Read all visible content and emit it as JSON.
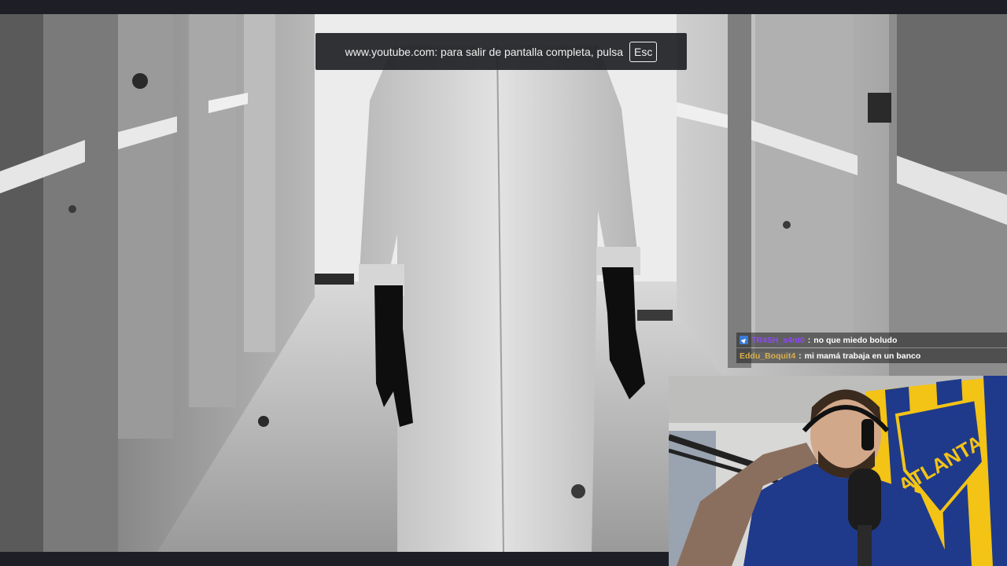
{
  "notice": {
    "text": "www.youtube.com: para salir de pantalla completa, pulsa",
    "key": "Esc"
  },
  "chat": {
    "messages": [
      {
        "user": "TR4SH_s4nt0",
        "separator": ":",
        "text": "no que miedo boludo",
        "user_color": "#9146ff",
        "badge": "prime-icon"
      },
      {
        "user": "Eddu_Boquit4",
        "separator": ":",
        "text": "mi mamá trabaja en un banco",
        "user_color": "#d9b04a"
      }
    ]
  },
  "webcam": {
    "flag_text": "ATLANTA",
    "flag_colors": {
      "blue": "#1f3a8a",
      "yellow": "#f3c316"
    }
  },
  "colors": {
    "notice_bg": "#202124",
    "page_bg": "#1e1f26"
  }
}
